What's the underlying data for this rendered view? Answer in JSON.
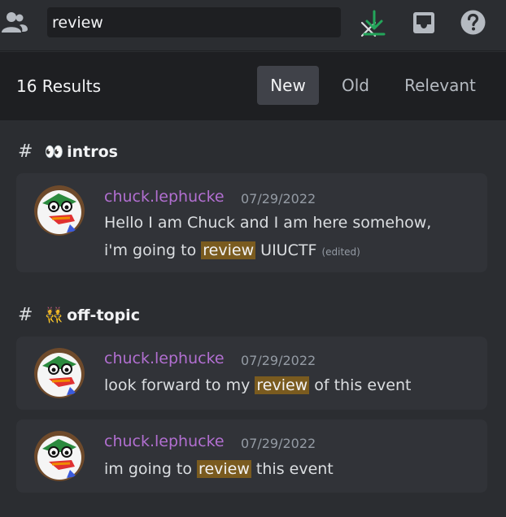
{
  "search": {
    "query": "review"
  },
  "results": {
    "count_label": "16 Results",
    "sort_tabs": [
      "New",
      "Old",
      "Relevant"
    ]
  },
  "groups": [
    {
      "channel": "intros",
      "emoji": "👀",
      "messages": [
        {
          "author": "chuck.lephucke",
          "timestamp": "07/29/2022",
          "line1": "Hello I am Chuck and I am here somehow,",
          "line2_before": "i'm going to ",
          "highlight": "review",
          "line2_after": " UIUCTF ",
          "edited": "(edited)"
        }
      ]
    },
    {
      "channel": "off-topic",
      "emoji": "👯",
      "messages": [
        {
          "author": "chuck.lephucke",
          "timestamp": "07/29/2022",
          "before": "look forward to my ",
          "highlight": "review",
          "after": " of this event"
        },
        {
          "author": "chuck.lephucke",
          "timestamp": "07/29/2022",
          "before": "im going to ",
          "highlight": "review",
          "after": " this event"
        }
      ]
    }
  ],
  "colors": {
    "background": "#2b2d31",
    "results_bar": "#1e1f22",
    "card": "#313338",
    "author": "#b26fd1",
    "highlight": "#7a5b1f",
    "download_green": "#23a55a"
  },
  "icons": {
    "members": "members-icon",
    "clear": "close-icon",
    "download": "download-icon",
    "inbox": "inbox-icon",
    "help": "help-icon"
  }
}
